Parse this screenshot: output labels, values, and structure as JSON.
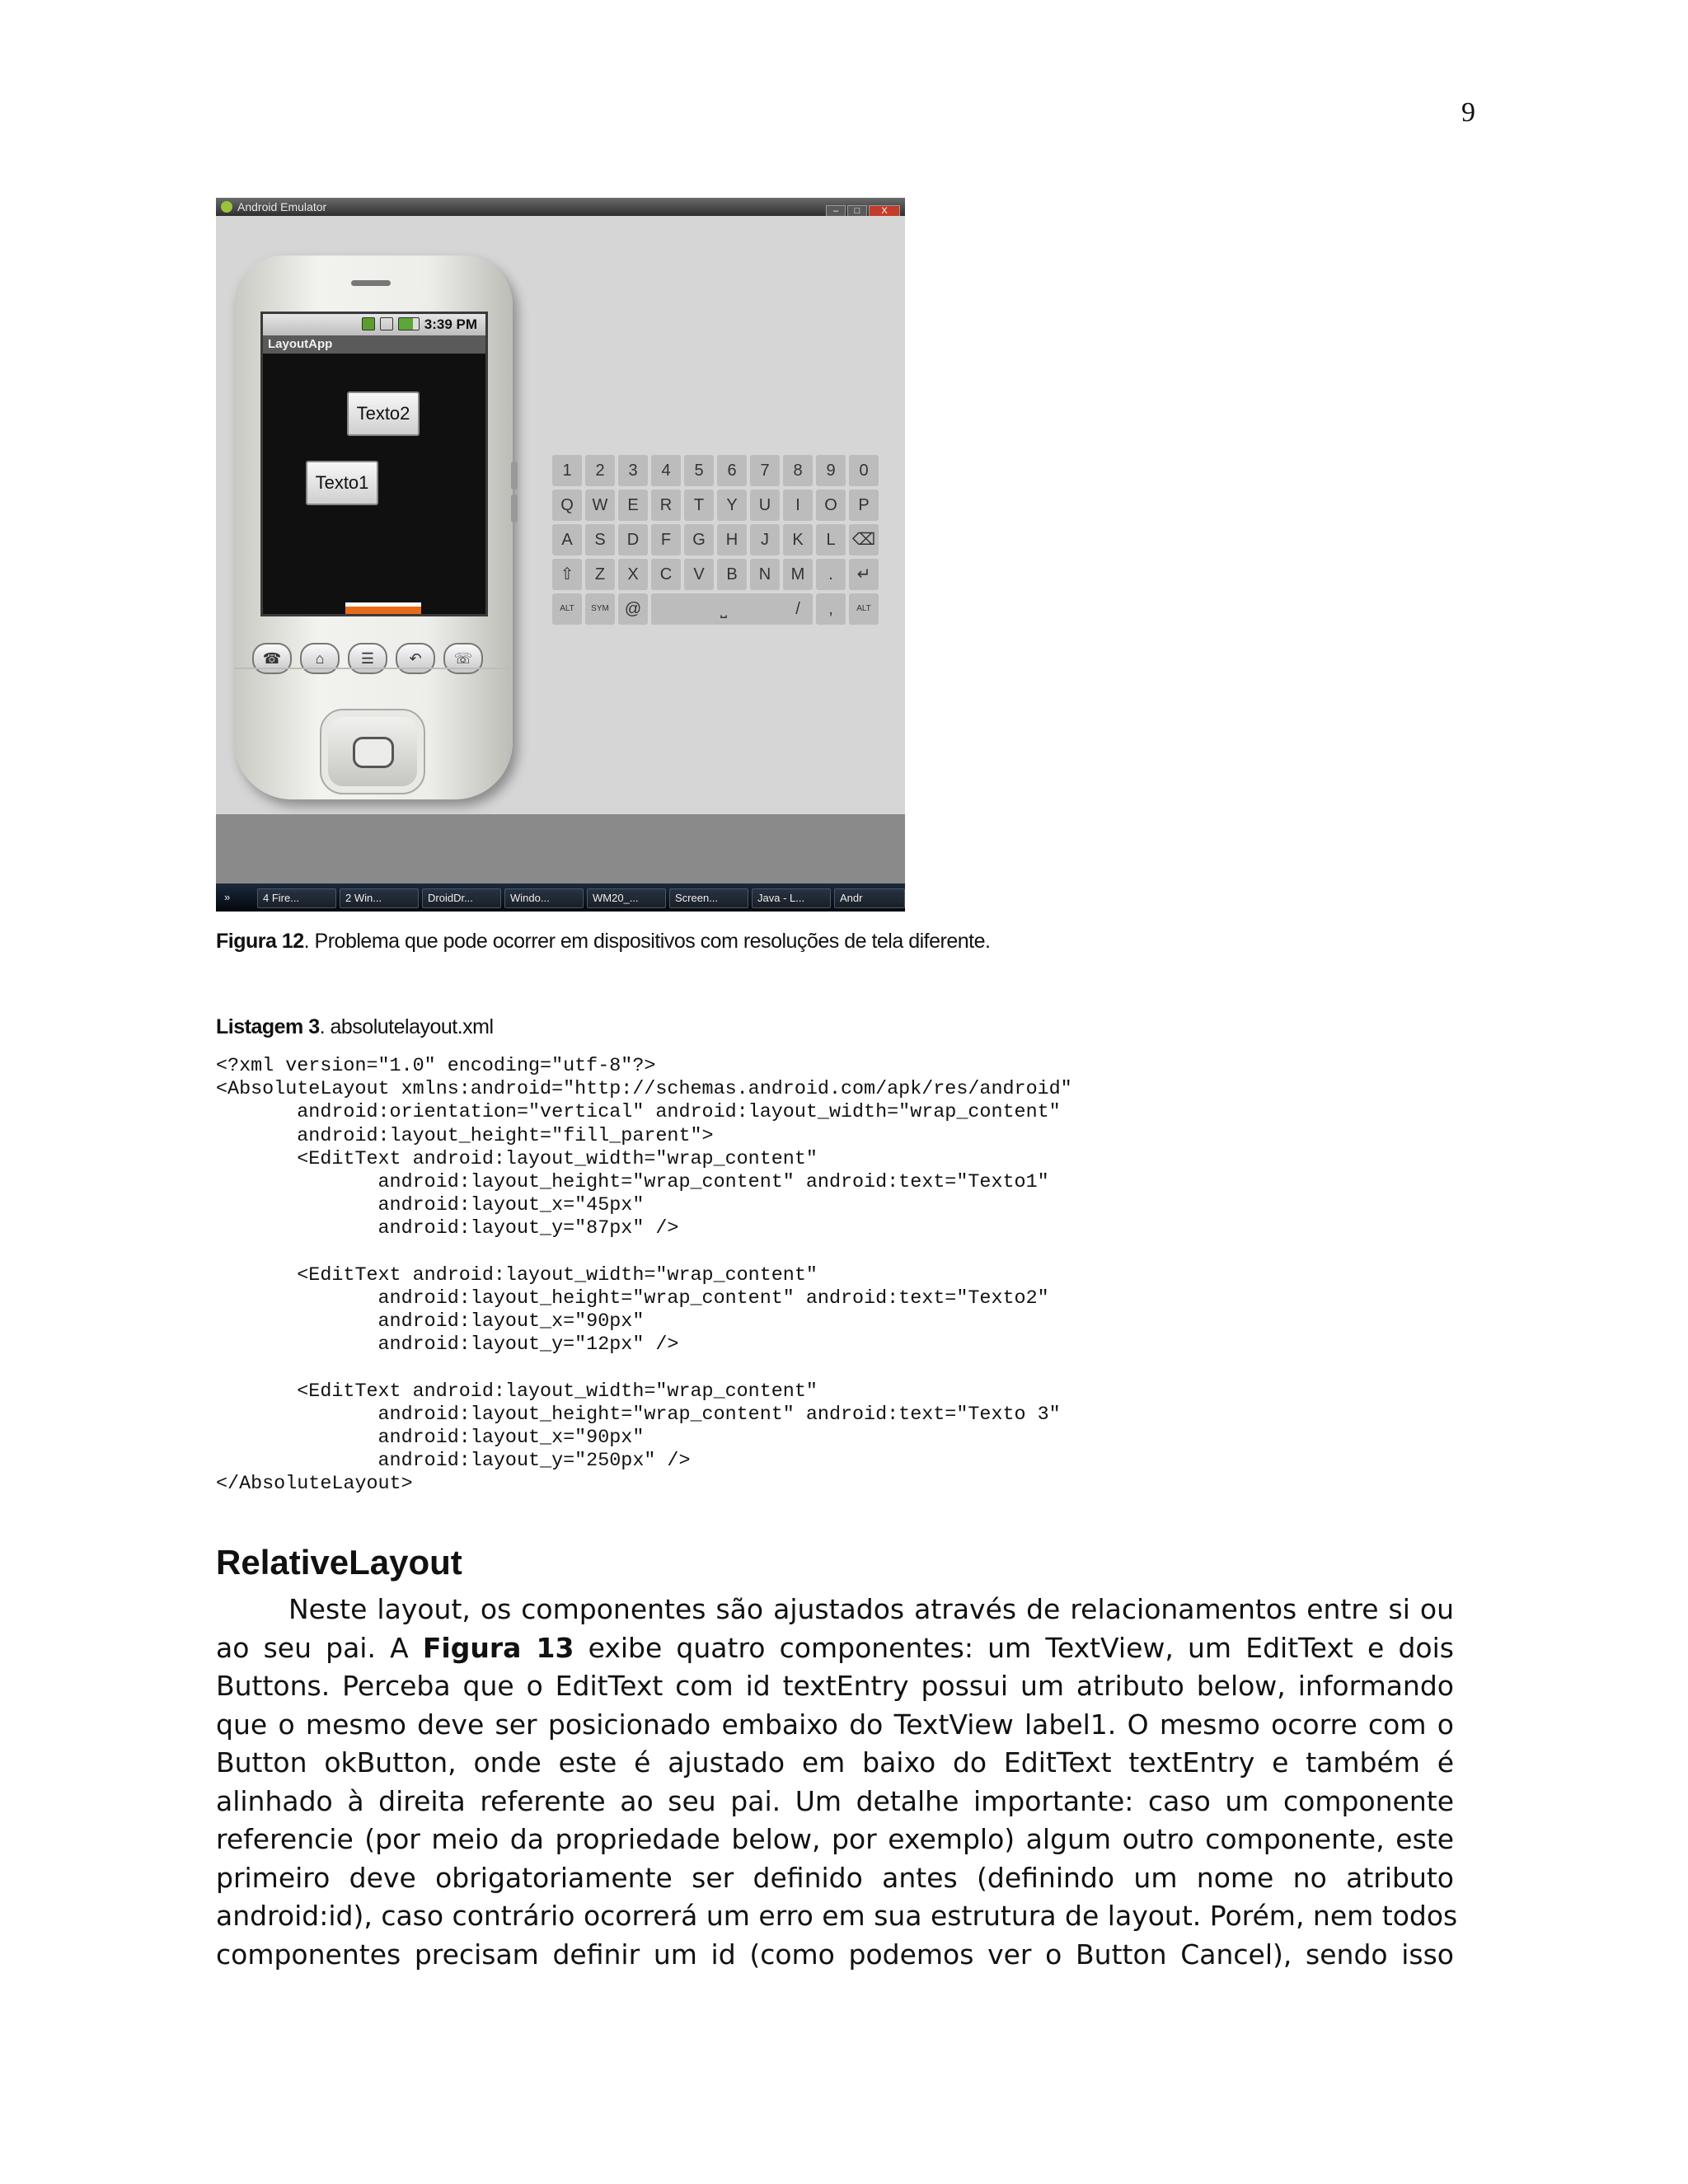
{
  "page_number": "9",
  "figure": {
    "window_title": "Android Emulator",
    "window_buttons": [
      "–",
      "□",
      "X"
    ],
    "status_time": "3:39 PM",
    "app_title": "LayoutApp",
    "edit_texts": [
      "Texto2",
      "Texto1"
    ],
    "keyboard_rows": [
      [
        "1",
        "2",
        "3",
        "4",
        "5",
        "6",
        "7",
        "8",
        "9",
        "0"
      ],
      [
        "Q",
        "W",
        "E",
        "R",
        "T",
        "Y",
        "U",
        "I",
        "O",
        "P"
      ],
      [
        "A",
        "S",
        "D",
        "F",
        "G",
        "H",
        "J",
        "K",
        "L",
        "⌫"
      ],
      [
        "⇧",
        "Z",
        "X",
        "C",
        "V",
        "B",
        "N",
        "M",
        ".",
        "↵"
      ],
      [
        "ALT",
        "SYM",
        "@",
        "⎵",
        "/",
        ",",
        "ALT"
      ]
    ],
    "taskbar_items": [
      "»",
      "4 Fire...",
      "2 Win...",
      "DroidDr...",
      "Windo...",
      "WM20_...",
      "Screen...",
      "Java - L...",
      "Andr"
    ]
  },
  "caption": {
    "label": "Figura 12",
    "text": ". Problema que pode ocorrer em dispositivos com resoluções de tela diferente."
  },
  "listing": {
    "label": "Listagem 3",
    "text": ". absolutelayout.xml",
    "code_lines": [
      "<?xml version=\"1.0\" encoding=\"utf-8\"?>",
      "<AbsoluteLayout xmlns:android=\"http://schemas.android.com/apk/res/android\"",
      "       android:orientation=\"vertical\" android:layout_width=\"wrap_content\"",
      "       android:layout_height=\"fill_parent\">",
      "       <EditText android:layout_width=\"wrap_content\"",
      "              android:layout_height=\"wrap_content\" android:text=\"Texto1\"",
      "              android:layout_x=\"45px\"",
      "              android:layout_y=\"87px\" />",
      "",
      "       <EditText android:layout_width=\"wrap_content\"",
      "              android:layout_height=\"wrap_content\" android:text=\"Texto2\"",
      "              android:layout_x=\"90px\"",
      "              android:layout_y=\"12px\" />",
      "",
      "       <EditText android:layout_width=\"wrap_content\"",
      "              android:layout_height=\"wrap_content\" android:text=\"Texto 3\"",
      "              android:layout_x=\"90px\"",
      "              android:layout_y=\"250px\" />",
      "</AbsoluteLayout>"
    ]
  },
  "section": {
    "heading": "RelativeLayout",
    "lines": [
      "Neste layout, os componentes são ajustados através de relacionamentos entre si ou",
      "ao seu pai. A |Figura 13| exibe quatro componentes: um TextView, um EditText e dois",
      "Buttons. Perceba que o EditText com id textEntry possui um atributo below, informando",
      "que o mesmo deve ser posicionado embaixo do TextView label1. O mesmo ocorre com o",
      "Button okButton, onde este é ajustado em baixo do EditText textEntry e também é",
      "alinhado à direita referente ao seu pai. Um detalhe importante: caso um componente",
      "referencie (por meio da propriedade below, por exemplo) algum outro componente, este",
      "primeiro deve obrigatoriamente ser definido antes (definindo um nome no atributo",
      "android:id), caso contrário ocorrerá um erro em sua estrutura de layout. Porém, nem todos",
      "componentes precisam definir um id (como podemos ver o Button Cancel), sendo isso"
    ]
  }
}
